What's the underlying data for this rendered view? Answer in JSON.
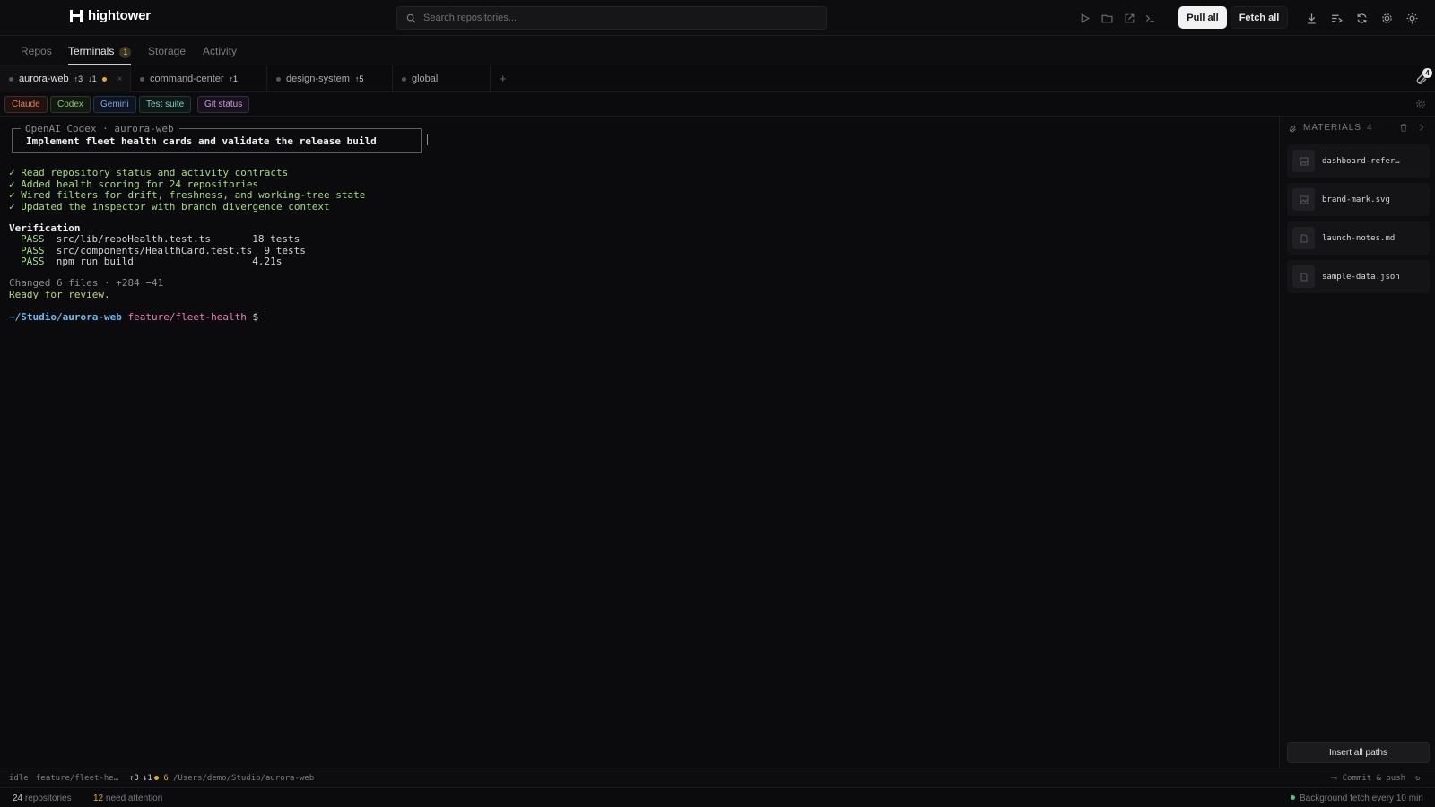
{
  "app": {
    "name": "hightower"
  },
  "search": {
    "placeholder": "Search repositories..."
  },
  "toolbar": {
    "pull_all": "Pull all",
    "fetch_all": "Fetch all",
    "icons": [
      "play-icon",
      "folder-icon",
      "external-link-icon",
      "terminal-icon",
      "download-icon",
      "list-icon",
      "refresh-icon",
      "gear-icon",
      "sun-icon"
    ]
  },
  "nav": {
    "tabs": [
      {
        "label": "Repos"
      },
      {
        "label": "Terminals",
        "badge": "1"
      },
      {
        "label": "Storage"
      },
      {
        "label": "Activity"
      }
    ],
    "active": "Terminals"
  },
  "terminal_tabs": [
    {
      "name": "aurora-web",
      "ahead": "↑3",
      "behind": "↓1",
      "dirty": true,
      "active": true,
      "close": "×"
    },
    {
      "name": "command-center",
      "ahead": "↑1"
    },
    {
      "name": "design-system",
      "ahead": "↑5"
    },
    {
      "name": "global"
    }
  ],
  "terminal_tabs_add": "+",
  "materials_badge": "4",
  "agents": [
    {
      "label": "Claude",
      "color": "#e07a5f"
    },
    {
      "label": "Codex",
      "color": "#8fbf7f"
    },
    {
      "label": "Gemini",
      "color": "#7ea6e0"
    },
    {
      "label": "Test suite",
      "color": "#7ecfc3"
    },
    {
      "label": "Git status",
      "color": "#c89be0"
    }
  ],
  "terminal": {
    "box_title": "OpenAI Codex · aurora-web",
    "box_text": "Implement fleet health cards and validate the release build",
    "checks": [
      "✓ Read repository status and activity contracts",
      "✓ Added health scoring for 24 repositories",
      "✓ Wired filters for drift, freshness, and working-tree state",
      "✓ Updated the inspector with branch divergence context"
    ],
    "verification_title": "Verification",
    "results": [
      {
        "status": "PASS",
        "text": "src/lib/repoHealth.test.ts       18 tests"
      },
      {
        "status": "PASS",
        "text": "src/components/HealthCard.test.ts  9 tests"
      },
      {
        "status": "PASS",
        "text": "npm run build                    4.21s"
      }
    ],
    "changed": "Changed 6 files · +284 −41",
    "ready": "Ready for review.",
    "prompt_path": "~/Studio/aurora-web",
    "prompt_branch": "feature/fleet-health",
    "prompt_symbol": "$"
  },
  "materials": {
    "title": "MATERIALS",
    "count": "4",
    "items": [
      {
        "name": "dashboard-refer…",
        "kind": "image-icon"
      },
      {
        "name": "brand-mark.svg",
        "kind": "image-icon"
      },
      {
        "name": "launch-notes.md",
        "kind": "file-icon"
      },
      {
        "name": "sample-data.json",
        "kind": "file-icon"
      }
    ],
    "insert_all": "Insert all paths"
  },
  "statusbar": {
    "state": "idle",
    "branch": "feature/fleet-he…",
    "ahead": "↑3",
    "behind": "↓1",
    "changes": "6",
    "path": "/Users/demo/Studio/aurora-web",
    "commit_push": "Commit & push"
  },
  "footer": {
    "repositories_count": "24",
    "repositories_label": "repositories",
    "attention_count": "12",
    "attention_label": "need attention",
    "background_fetch": "Background fetch every 10 min"
  }
}
